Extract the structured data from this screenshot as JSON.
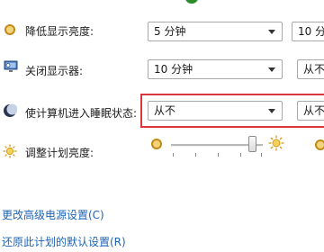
{
  "rows": [
    {
      "label": "降低显示亮度:",
      "dropdown1": "5 分钟",
      "dropdown2": "10 分"
    },
    {
      "label": "关闭显示器:",
      "dropdown1": "10 分钟",
      "dropdown2": "从不"
    },
    {
      "label": "使计算机进入睡眠状态:",
      "dropdown1": "从不",
      "dropdown2": "从不"
    },
    {
      "label": "调整计划亮度:"
    }
  ],
  "brightness": {
    "level_fraction": 0.92
  },
  "links": {
    "advanced": "更改高级电源设置(C)",
    "restore": "还原此计划的默认设置(R)"
  },
  "colors": {
    "link": "#1d63b6",
    "highlight": "#d9383d"
  },
  "icons": {
    "dim": "dim-brightness-icon",
    "display": "monitor-icon",
    "sleep": "moon-icon",
    "brightness": "sun-icon"
  }
}
